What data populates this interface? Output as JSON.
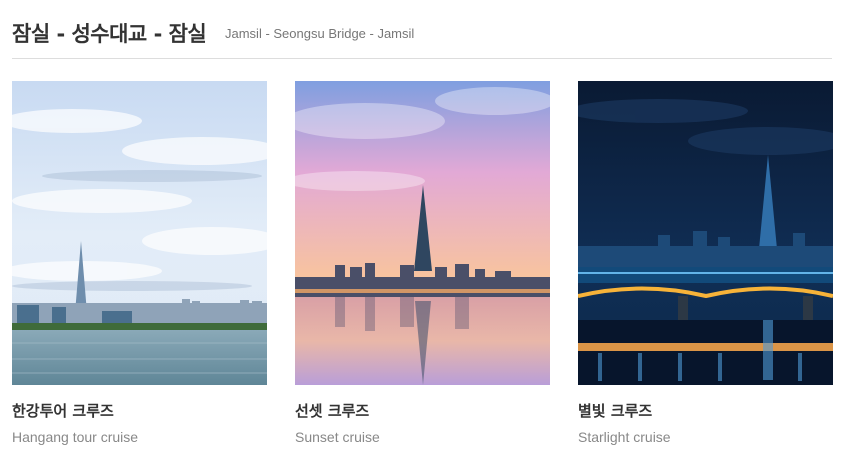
{
  "header": {
    "title": "잠실 - 성수대교 - 잠실",
    "subtitle": "Jamsil - Seongsu Bridge - Jamsil"
  },
  "cards": [
    {
      "title_kr": "한강투어 크루즈",
      "title_en": "Hangang tour cruise"
    },
    {
      "title_kr": "선셋 크루즈",
      "title_en": "Sunset cruise"
    },
    {
      "title_kr": "별빛 크루즈",
      "title_en": "Starlight cruise"
    }
  ]
}
